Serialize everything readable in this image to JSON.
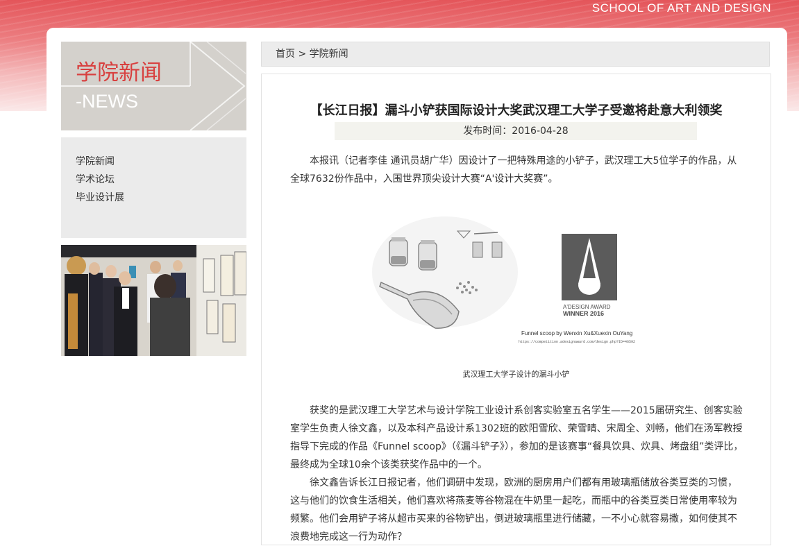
{
  "header": {
    "school_name": "SCHOOL OF ART AND DESIGN"
  },
  "hero": {
    "title_cn": "学院新闻",
    "title_en": "-NEWS"
  },
  "sidebar": {
    "items": [
      {
        "label": "学院新闻"
      },
      {
        "label": "学术论坛"
      },
      {
        "label": "毕业设计展"
      }
    ]
  },
  "breadcrumb": {
    "home": "首页",
    "separator": ">",
    "current": "学院新闻"
  },
  "article": {
    "title": "【长江日报】漏斗小铲获国际设计大奖武汉理工大学子受邀将赴意大利领奖",
    "publish_date": "发布时间：2016-04-28",
    "intro": "本报讯（记者李佳 通讯员胡广华）因设计了一把特殊用途的小铲子，武汉理工大5位学子的作品，从全球7632份作品中，入围世界顶尖设计大赛“A'设计大奖赛”。",
    "figure": {
      "award_line1": "A'DESIGN AWARD",
      "award_line2": "WINNER  2016",
      "credit": "Funnel scoop by Wenxin Xu&Xuexin OuYang",
      "url": "https://competition.adesignaward.com/design.php?ID=46592"
    },
    "caption": "武汉理工大学子设计的漏斗小铲",
    "paragraphs": [
      "获奖的是武汉理工大学艺术与设计学院工业设计系创客实验室五名学生——2015届研究生、创客实验室学生负责人徐文鑫，以及本科产品设计系1302班的欧阳雪欣、荣雪晴、宋周全、刘畅，他们在汤军教授指导下完成的作品《Funnel scoop》（《漏斗铲子》），参加的是该赛事“餐具饮具、炊具、烤盘组”类评比，最终成为全球10余个该类获奖作品中的一个。",
      "徐文鑫告诉长江日报记者，他们调研中发现，欧洲的厨房用户们都有用玻璃瓶储放谷类豆类的习惯，这与他们的饮食生活相关，他们喜欢将燕麦等谷物混在牛奶里一起吃，而瓶中的谷类豆类日常使用率较为频繁。他们会用铲子将从超市买来的谷物铲出，倒进玻璃瓶里进行储藏，一不小心就容易撒，如何使其不浪费地完成这一行为动作？"
    ]
  },
  "colors": {
    "accent_red": "#d8403f",
    "hero_bg": "#d4d1cc",
    "menu_bg": "#ebebeb"
  }
}
